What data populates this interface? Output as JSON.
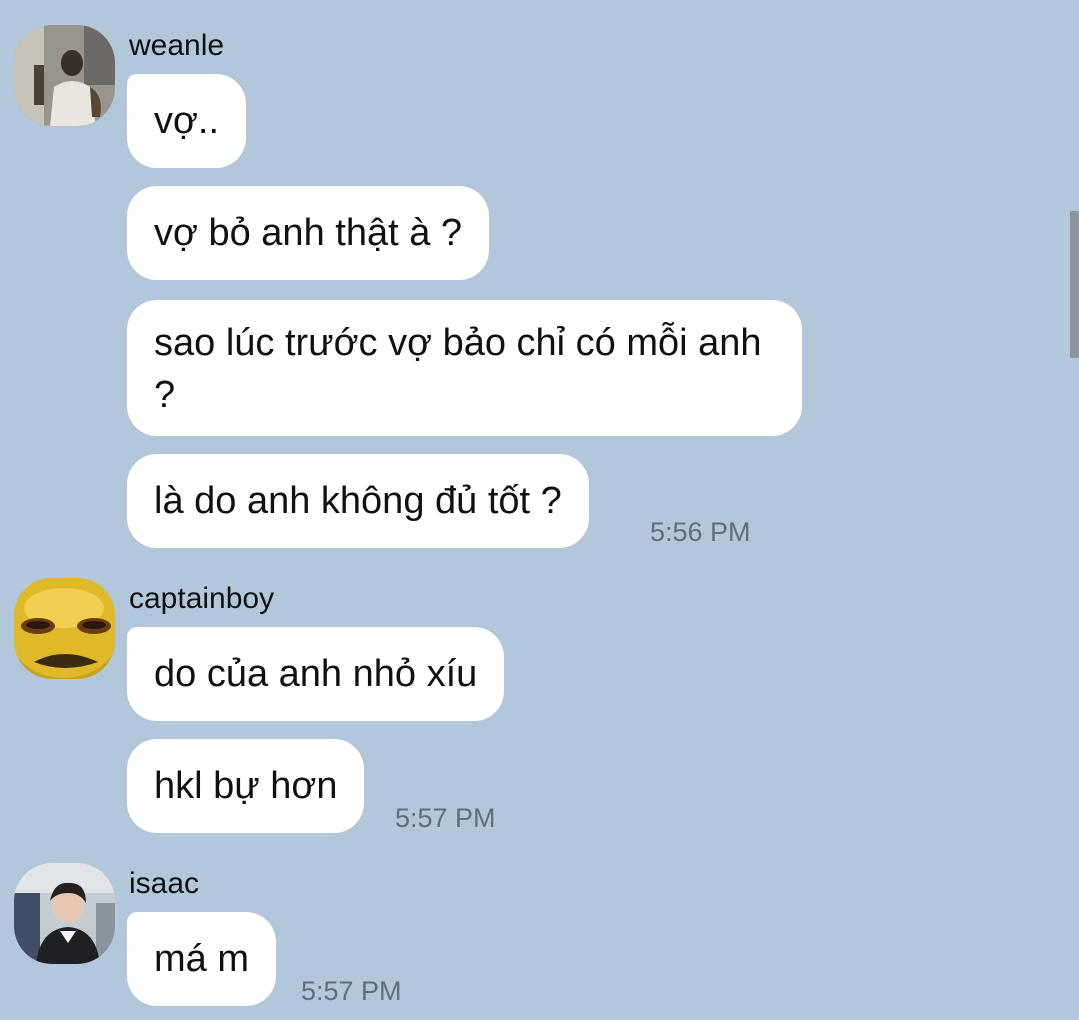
{
  "messages": [
    {
      "sender": "weanle",
      "avatar_icon": "user-avatar-photo",
      "bubbles": [
        "vợ..",
        "vợ bỏ anh thật à ?",
        "sao lúc trước vợ bảo chỉ có mỗi anh ?",
        "là do anh không đủ tốt ?"
      ],
      "time": "5:56 PM"
    },
    {
      "sender": "captainboy",
      "avatar_icon": "yellow-cartoon-face-avatar",
      "bubbles": [
        "do của anh nhỏ xíu",
        "hkl bự hơn"
      ],
      "time": "5:57 PM"
    },
    {
      "sender": "isaac",
      "avatar_icon": "user-avatar-photo",
      "bubbles": [
        "má m"
      ],
      "time": "5:57 PM"
    }
  ],
  "colors": {
    "background": "#b2c7da",
    "bubble": "#ffffff",
    "time_text": "#5f6f7f",
    "scrollbar": "#8b95a0"
  }
}
